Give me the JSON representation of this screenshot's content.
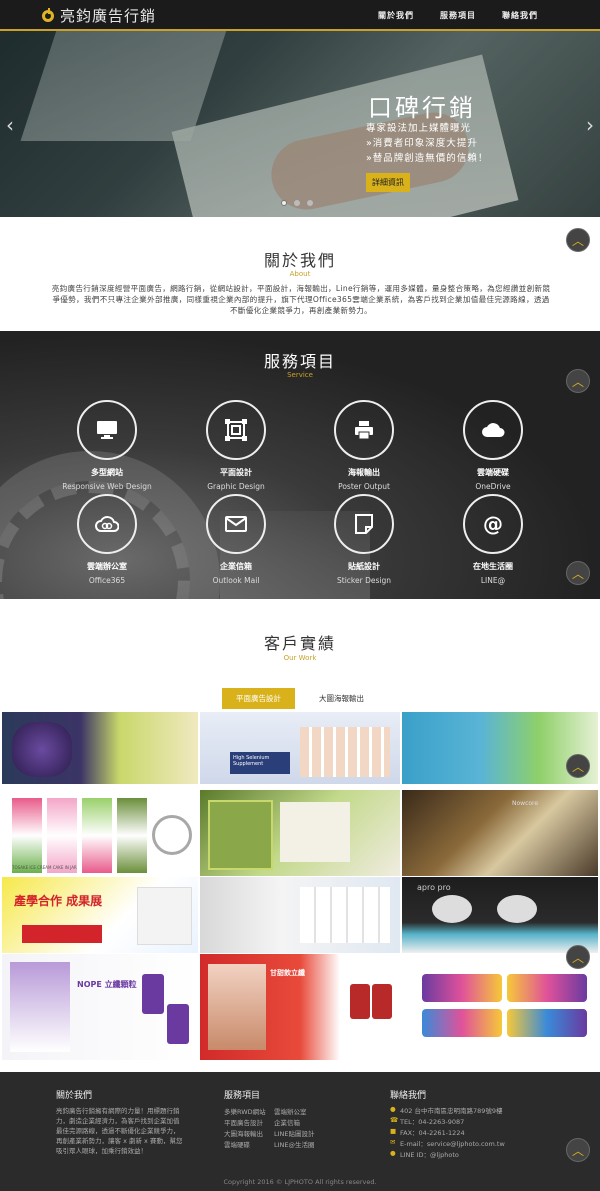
{
  "brand": {
    "name": "亮鈞廣告行銷",
    "accent": "#d9b21b"
  },
  "nav": {
    "items": [
      "關於我們",
      "服務項目",
      "聯絡我們"
    ]
  },
  "hero": {
    "title": "口碑行銷",
    "lines": [
      "專家設法加上媒體曝光",
      "»消費者印象深度大提升",
      "»替品牌創造無價的信賴！"
    ],
    "button": "詳細資訊",
    "slides": 3,
    "active_slide": 1
  },
  "about": {
    "title": "關於我們",
    "subtitle": "About",
    "text": "亮鈞廣告行銷深度經營平面廣告，網路行銷，從網站設計，平面設計，海報輸出，Line行銷等，運用多媒體，量身整合策略，為您經讚並創新競爭優勢，我們不只專注企業外部推廣，同樣重視企業內部的提升，旗下代理Office365雲端企業系統，為客戶找到企業加值最佳完源路線，透過不斷優化企業競爭力，再創產業新勢力。"
  },
  "service": {
    "title": "服務項目",
    "subtitle": "Service",
    "items": [
      {
        "name": "多型網站",
        "en": "Responsive Web Design",
        "icon": "monitor-icon"
      },
      {
        "name": "平面設計",
        "en": "Graphic Design",
        "icon": "frame-icon"
      },
      {
        "name": "海報輸出",
        "en": "Poster Output",
        "icon": "printer-icon"
      },
      {
        "name": "雲端硬碟",
        "en": "OneDrive",
        "icon": "cloud-icon"
      },
      {
        "name": "雲端辦公室",
        "en": "Office365",
        "icon": "link-cloud-icon"
      },
      {
        "name": "企業信箱",
        "en": "Outlook Mail",
        "icon": "mail-icon"
      },
      {
        "name": "貼紙設計",
        "en": "Sticker Design",
        "icon": "sticker-icon"
      },
      {
        "name": "在地生活圈",
        "en": "LINE@",
        "icon": "at-icon"
      }
    ]
  },
  "work": {
    "title": "客戶實績",
    "subtitle": "Our Work",
    "tabs": [
      "平面廣告設計",
      "大圖海報輸出"
    ],
    "tiles": [
      {
        "text": ""
      },
      {
        "text": "High Selenium Supplement"
      },
      {
        "text": ""
      },
      {
        "text": "TOSAKE  ICE CREAM  CAKE IN JAR"
      },
      {
        "text": ""
      },
      {
        "text": "Nowcore"
      },
      {
        "text": "產學合作 成果展"
      },
      {
        "text": ""
      },
      {
        "text": "apro pro"
      },
      {
        "text": "NOPE 立纖顆粒"
      },
      {
        "text": "甘甜飲立纖"
      },
      {
        "text": ""
      }
    ]
  },
  "footer": {
    "about_title": "關於我們",
    "about_text": "亮鈞廣告行銷擁有網際的力量！用標題行銷力，劇造企業經濟力，為客戶找到企業加值最佳完源路線，透過不斷優化企業競爭力，再創產業新勢力，讓客 x 劇新 x 賽動，幫您吸引眾人眼球，加乘行銷效益！",
    "service_title": "服務項目",
    "service_col1": [
      "多樂RWD網站",
      "平面廣告設計",
      "大圖海報輸出",
      "雲端硬碟"
    ],
    "service_col2": [
      "雲端辦公室",
      "企業信箱",
      "LINE貼圖設計",
      "LINE@生活圈"
    ],
    "contact_title": "聯絡我們",
    "contact": [
      "402 台中市南區忠明南路789號9樓",
      "TEL：04-2263-9087",
      "FAX：04-2261-1224",
      "E-mail：service@ljphoto.com.tw",
      "LINE ID：@ljphoto"
    ],
    "copyright": "Copyright 2016 © LJPHOTO All rights reserved."
  }
}
